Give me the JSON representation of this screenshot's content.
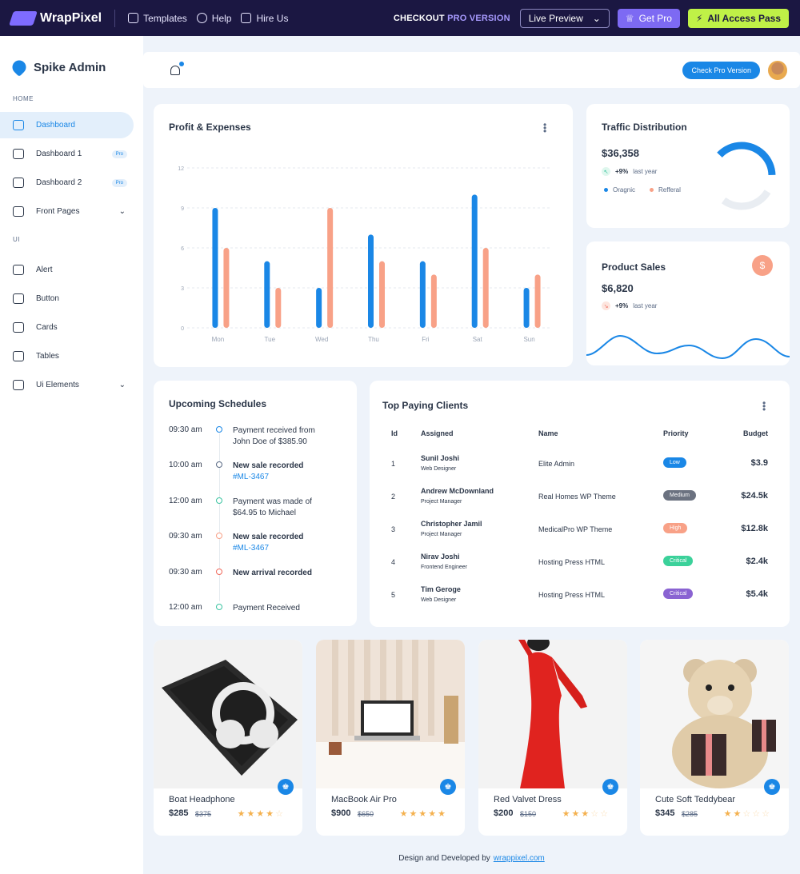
{
  "topbar": {
    "brand": "WrapPixel",
    "links": [
      "Templates",
      "Help",
      "Hire Us"
    ],
    "checkout_prefix": "CHECKOUT",
    "checkout_suffix": "PRO VERSION",
    "live_preview": "Live Preview",
    "get_pro": "Get Pro",
    "all_access": "All Access Pass"
  },
  "sidebar": {
    "brand": "Spike Admin",
    "home_caption": "HOME",
    "ui_caption": "UI",
    "home_items": [
      {
        "label": "Dashboard",
        "active": true,
        "badge": ""
      },
      {
        "label": "Dashboard 1",
        "active": false,
        "badge": "Pro"
      },
      {
        "label": "Dashboard 2",
        "active": false,
        "badge": "Pro"
      },
      {
        "label": "Front Pages",
        "active": false,
        "badge": "",
        "chevron": true
      }
    ],
    "ui_items": [
      {
        "label": "Alert"
      },
      {
        "label": "Button"
      },
      {
        "label": "Cards"
      },
      {
        "label": "Tables"
      },
      {
        "label": "Ui Elements",
        "chevron": true
      }
    ]
  },
  "header": {
    "check_pro": "Check Pro Version"
  },
  "profit": {
    "title": "Profit & Expenses"
  },
  "traffic": {
    "title": "Traffic Distribution",
    "value": "$36,358",
    "change": "+9%",
    "period": "last year",
    "legend": [
      {
        "label": "Oragnic",
        "color": "#1a87e6"
      },
      {
        "label": "Refferal",
        "color": "#f8a187"
      }
    ],
    "donut": {
      "organic_fraction": 0.38,
      "refferal_fraction": 0.35,
      "empty_fraction": 0.27
    }
  },
  "sales": {
    "title": "Product Sales",
    "value": "$6,820",
    "change": "+9%",
    "period": "last year",
    "dollar_symbol": "$"
  },
  "chart_data": {
    "type": "bar",
    "categories": [
      "Mon",
      "Tue",
      "Wed",
      "Thu",
      "Fri",
      "Sat",
      "Sun"
    ],
    "series": [
      {
        "values": [
          9,
          5,
          3,
          7,
          5,
          10,
          3
        ],
        "color": "#1a87e6"
      },
      {
        "values": [
          6,
          3,
          9,
          5,
          4,
          6,
          4
        ],
        "color": "#f8a187"
      }
    ],
    "title": "Profit & Expenses",
    "ylim": [
      0,
      12
    ],
    "yticks": [
      0,
      3,
      6,
      9,
      12
    ],
    "grid": true
  },
  "schedules": {
    "title": "Upcoming Schedules",
    "items": [
      {
        "time": "09:30 am",
        "text": "Payment received from John Doe of $385.90",
        "bold": false,
        "link": "",
        "color": "#1a87e6"
      },
      {
        "time": "10:00 am",
        "text": "New sale recorded",
        "bold": true,
        "link": "#ML-3467",
        "color": "#5a6a85"
      },
      {
        "time": "12:00 am",
        "text": "Payment was made of $64.95 to Michael",
        "bold": false,
        "link": "",
        "color": "#3bc4a1"
      },
      {
        "time": "09:30 am",
        "text": "New sale recorded",
        "bold": true,
        "link": "#ML-3467",
        "color": "#f8a187"
      },
      {
        "time": "09:30 am",
        "text": "New arrival recorded",
        "bold": true,
        "link": "",
        "color": "#f06a5d"
      },
      {
        "time": "12:00 am",
        "text": "Payment Received",
        "bold": false,
        "link": "",
        "color": "#3bc4a1"
      }
    ]
  },
  "clients": {
    "title": "Top Paying Clients",
    "headers": [
      "Id",
      "Assigned",
      "Name",
      "Priority",
      "Budget"
    ],
    "rows": [
      {
        "id": "1",
        "assigned": "Sunil Joshi",
        "role": "Web Designer",
        "name": "Elite Admin",
        "priority": "Low",
        "prio_color": "#1a87e6",
        "budget": "$3.9"
      },
      {
        "id": "2",
        "assigned": "Andrew McDownland",
        "role": "Project Manager",
        "name": "Real Homes WP Theme",
        "priority": "Medium",
        "prio_color": "#6b7280",
        "budget": "$24.5k"
      },
      {
        "id": "3",
        "assigned": "Christopher Jamil",
        "role": "Project Manager",
        "name": "MedicalPro WP Theme",
        "priority": "High",
        "prio_color": "#f8a187",
        "budget": "$12.8k"
      },
      {
        "id": "4",
        "assigned": "Nirav Joshi",
        "role": "Frontend Engineer",
        "name": "Hosting Press HTML",
        "priority": "Critical",
        "prio_color": "#3bd19a",
        "budget": "$2.4k"
      },
      {
        "id": "5",
        "assigned": "Tim Geroge",
        "role": "Web Designer",
        "name": "Hosting Press HTML",
        "priority": "Critical",
        "prio_color": "#8a63d2",
        "budget": "$5.4k"
      }
    ]
  },
  "products": [
    {
      "name": "Boat Headphone",
      "price": "$285",
      "old": "$375",
      "rating": 4
    },
    {
      "name": "MacBook Air Pro",
      "price": "$900",
      "old": "$650",
      "rating": 5
    },
    {
      "name": "Red Valvet Dress",
      "price": "$200",
      "old": "$150",
      "rating": 3
    },
    {
      "name": "Cute Soft Teddybear",
      "price": "$345",
      "old": "$285",
      "rating": 2
    }
  ],
  "footer": {
    "text": "Design and Developed by",
    "link": "wrappixel.com"
  }
}
